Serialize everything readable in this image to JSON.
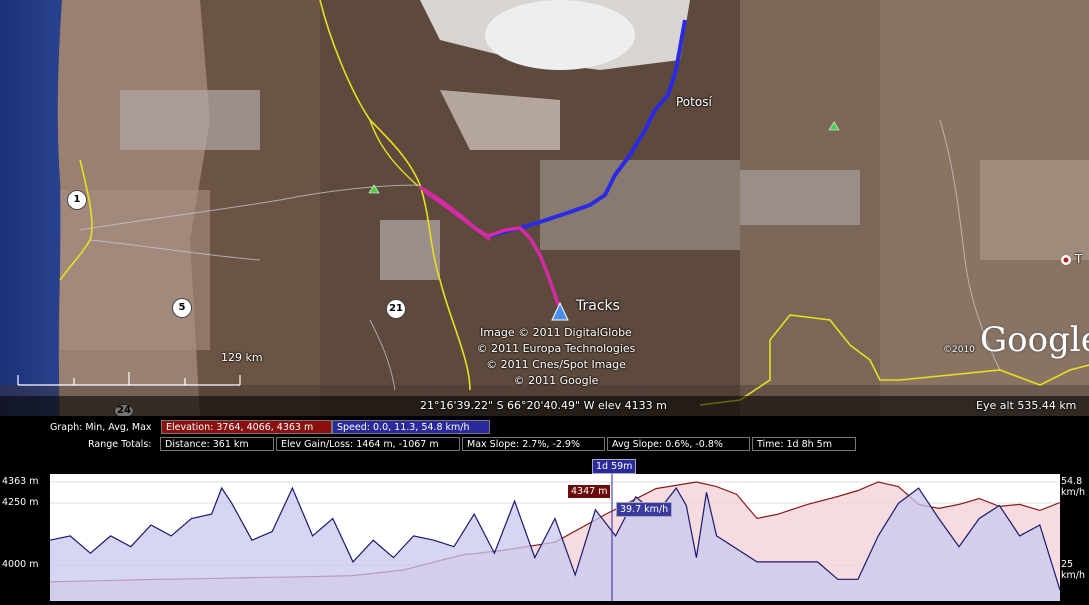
{
  "map": {
    "places": {
      "potosi": "Potosí",
      "tracks": "Tracks",
      "edge_place": "T"
    },
    "road_shields": [
      "1",
      "5",
      "21",
      "24"
    ],
    "scale_label": "129 km",
    "attribution": [
      "Image © 2011 DigitalGlobe",
      "© 2011 Europa Technologies",
      "© 2011 Cnes/Spot Image",
      "© 2011 Google"
    ],
    "logo_copyright": "©2010",
    "logo": "Google",
    "status": {
      "coords": "21°16'39.22\" S   66°20'40.49\" W  elev 4133 m",
      "eye_alt": "Eye alt   535.44 km"
    },
    "colors": {
      "track_blue": "#2a2ae6",
      "track_magenta": "#d42aa5",
      "road": "#e8e020"
    }
  },
  "panel": {
    "graph_label": "Graph: Min, Avg, Max",
    "elevation": "Elevation: 3764, 4066, 4363 m",
    "speed": "Speed: 0.0, 11.3, 54.8 km/h",
    "range_label": "Range Totals:",
    "distance": "Distance: 361 km",
    "elev_gain": "Elev Gain/Loss: 1464 m, -1067 m",
    "max_slope": "Max Slope: 2.7%, -2.9%",
    "avg_slope": "Avg Slope: 0.6%, -0.8%",
    "time": "Time: 1d 8h 5m",
    "colors": {
      "elevation_box": "#8a1010",
      "speed_box": "#2a2a9a"
    }
  },
  "chart_data": {
    "type": "line",
    "y_left_labels": [
      "4363 m",
      "4250 m",
      "4000 m"
    ],
    "y_right_labels": [
      "54.8 km/h",
      "25 km/h"
    ],
    "cursor": {
      "time": "1d 59m",
      "elevation": "4347 m",
      "speed": "39.7 km/h"
    },
    "series": [
      {
        "name": "Elevation",
        "unit": "m",
        "color": "#8a1a1a",
        "fill": "#f3d0d6",
        "ylim": [
          3764,
          4363
        ],
        "x": [
          0,
          5,
          10,
          15,
          20,
          25,
          30,
          35,
          38,
          41,
          42,
          45,
          50,
          55,
          60,
          64,
          66,
          68,
          70,
          72,
          75,
          78,
          80,
          82,
          84,
          86,
          88,
          90,
          92,
          94,
          96,
          98,
          100
        ],
        "values": [
          3860,
          3866,
          3872,
          3876,
          3882,
          3886,
          3892,
          3920,
          3960,
          3998,
          4002,
          4020,
          4060,
          4200,
          4330,
          4363,
          4340,
          4300,
          4180,
          4200,
          4250,
          4290,
          4320,
          4363,
          4340,
          4250,
          4230,
          4250,
          4280,
          4240,
          4250,
          4220,
          4260
        ]
      },
      {
        "name": "Speed",
        "unit": "km/h",
        "color": "#1a1a6a",
        "fill": "#c8c8f0",
        "ylim": [
          0,
          54.8
        ],
        "x": [
          0,
          2,
          4,
          6,
          8,
          10,
          12,
          14,
          16,
          17,
          18,
          20,
          22,
          24,
          26,
          28,
          30,
          32,
          34,
          36,
          38,
          40,
          42,
          44,
          46,
          48,
          50,
          52,
          54,
          56,
          58,
          60,
          62,
          63,
          64,
          65,
          66,
          70,
          72,
          74,
          76,
          78,
          80,
          82,
          84,
          86,
          88,
          90,
          92,
          94,
          96,
          98,
          100
        ],
        "values": [
          28,
          30,
          22,
          30,
          25,
          35,
          30,
          38,
          40,
          52,
          45,
          28,
          32,
          52,
          30,
          38,
          18,
          28,
          20,
          30,
          28,
          25,
          40,
          22,
          46,
          20,
          38,
          12,
          42,
          30,
          48,
          40,
          52,
          44,
          20,
          50,
          30,
          18,
          18,
          18,
          18,
          10,
          10,
          30,
          45,
          52,
          38,
          25,
          38,
          44,
          30,
          35,
          5
        ]
      }
    ]
  }
}
